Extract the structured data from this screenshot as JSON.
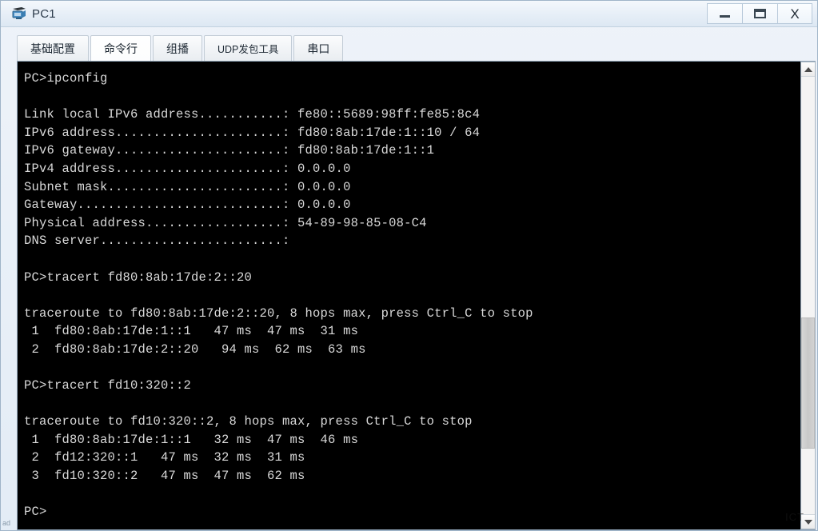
{
  "window": {
    "title": "PC1",
    "icon": "pc-device-icon",
    "controls": {
      "minimize": "minimize-button",
      "maximize": "maximize-button",
      "close": "close-button",
      "minimize_glyph": "",
      "maximize_glyph": "",
      "close_glyph": "X"
    }
  },
  "tabs": [
    {
      "label": "基础配置",
      "active": false
    },
    {
      "label": "命令行",
      "active": true
    },
    {
      "label": "组播",
      "active": false
    },
    {
      "label": "UDP发包工具",
      "active": false
    },
    {
      "label": "串口",
      "active": false
    }
  ],
  "terminal": {
    "background": "#000000",
    "foreground": "#d9d9d9",
    "lines": [
      "PC>ipconfig",
      "",
      "Link local IPv6 address...........: fe80::5689:98ff:fe85:8c4",
      "IPv6 address......................: fd80:8ab:17de:1::10 / 64",
      "IPv6 gateway......................: fd80:8ab:17de:1::1",
      "IPv4 address......................: 0.0.0.0",
      "Subnet mask.......................: 0.0.0.0",
      "Gateway...........................: 0.0.0.0",
      "Physical address..................: 54-89-98-85-08-C4",
      "DNS server........................:",
      "",
      "PC>tracert fd80:8ab:17de:2::20",
      "",
      "traceroute to fd80:8ab:17de:2::20, 8 hops max, press Ctrl_C to stop",
      " 1  fd80:8ab:17de:1::1   47 ms  47 ms  31 ms",
      " 2  fd80:8ab:17de:2::20   94 ms  62 ms  63 ms",
      "",
      "PC>tracert fd10:320::2",
      "",
      "traceroute to fd10:320::2, 8 hops max, press Ctrl_C to stop",
      " 1  fd80:8ab:17de:1::1   32 ms  47 ms  46 ms",
      " 2  fd12:320::1   47 ms  32 ms  31 ms",
      " 3  fd10:320::2   47 ms  47 ms  62 ms",
      "",
      "PC>"
    ]
  },
  "scrollbar": {
    "up_arrow": "scroll-up-arrow",
    "down_arrow": "scroll-down-arrow"
  },
  "watermark": {
    "text": "ICT"
  },
  "corner": {
    "text": "ad"
  }
}
